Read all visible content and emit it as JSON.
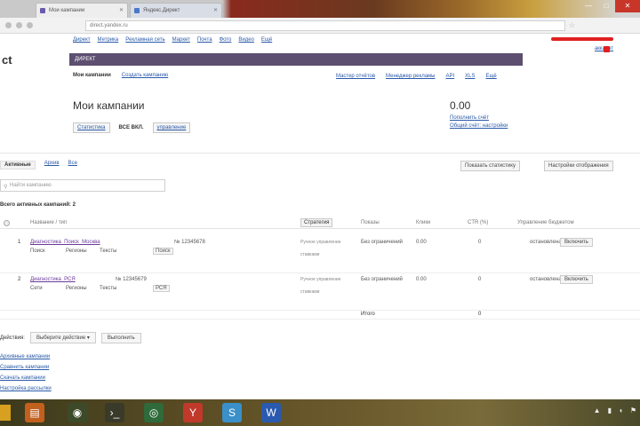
{
  "browser": {
    "tabs": [
      {
        "label": "Мои кампании",
        "active": true
      },
      {
        "label": "Яндекс.Директ",
        "active": false
      }
    ],
    "address_placeholder": "direct.yandex.ru",
    "window_controls": [
      "—",
      "□",
      "✕"
    ]
  },
  "page": {
    "logo": "ct",
    "topnav": [
      "Директ",
      "Метрика",
      "Рекламная сеть",
      "Маркет",
      "Почта",
      "Фото",
      "Видео",
      "Ещё"
    ],
    "account_link": "аккаунт",
    "campaign_band_text": "ДИРЕКТ",
    "subtabs": [
      {
        "label": "Мои кампании",
        "active": true
      },
      {
        "label": "Создать кампанию",
        "active": false
      }
    ],
    "right_links": [
      "Мастер отчётов",
      "Менеджер рекламы",
      "API",
      "XLS",
      "Ещё"
    ],
    "title": "Мои кампании",
    "title_controls": {
      "left_chip": "Статистика",
      "middle": "ВСЕ ВКЛ.",
      "right_chip": "управление"
    },
    "balance": {
      "amount": "0.00",
      "link1": "Пополнить счёт",
      "link2": "Общий счёт: настройки"
    },
    "filter_tabs": [
      {
        "label": "Активные",
        "active": true
      },
      {
        "label": "Архив",
        "active": false
      },
      {
        "label": "Все",
        "active": false
      }
    ],
    "top_buttons": [
      "Показать статистику",
      "Настройки отображения"
    ],
    "search_placeholder": "Найти кампанию",
    "section_label": "Всего активных кампаний: 2"
  },
  "table": {
    "headers": {
      "name": "Название / тип",
      "sort": "Стратегия",
      "col3": "Показы",
      "col4": "Клики",
      "col5": "CTR (%)",
      "col6": "Управление бюджетом"
    },
    "rows": [
      {
        "num": "1",
        "name": "Диагностика_Поиск_Москва",
        "id": "№ 12345678",
        "meta": [
          "Поиск",
          "Регионы",
          "Тексты"
        ],
        "badge": "Поиск",
        "strategy": "Ручное управление",
        "strategy_sub": "ставками",
        "period": "Без ограничений",
        "spent": "0.00",
        "clicks": "0",
        "status": "остановлена",
        "action": "Включить"
      },
      {
        "num": "2",
        "name": "Диагностика_РСЯ",
        "id": "№ 12345679",
        "meta": [
          "Сети",
          "Регионы",
          "Тексты"
        ],
        "badge": "РСЯ",
        "strategy": "Ручное управление",
        "strategy_sub": "ставками",
        "period": "Без ограничений",
        "spent": "0.00",
        "clicks": "0",
        "status": "остановлена",
        "action": "Включить"
      }
    ],
    "totals": {
      "label": "Итого",
      "clicks": "0"
    }
  },
  "bulk_actions": {
    "label": "Действия:",
    "select": "Выберите действие ▾",
    "apply": "Выполнить"
  },
  "bottom_links": [
    "Архивные кампании",
    "Сравнить кампании",
    "Скачать кампании",
    "Настройка рассылки"
  ],
  "colors": {
    "band": "#5d4f70",
    "link": "#2a5aa8",
    "campaign_link": "#6a3a9a",
    "alert": "#e02020"
  }
}
